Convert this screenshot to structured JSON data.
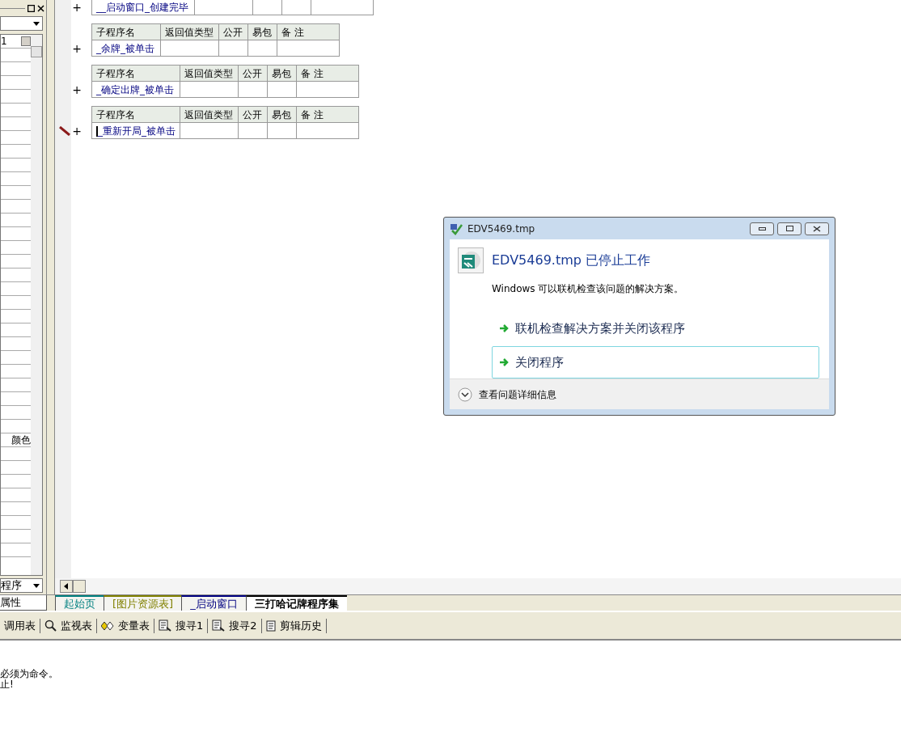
{
  "left_panel": {
    "field_text": "1",
    "rows": [
      {
        "kind": "blank"
      },
      {
        "kind": "blank"
      },
      {
        "kind": "blank"
      },
      {
        "kind": "blank"
      },
      {
        "kind": "blank"
      },
      {
        "kind": "blank"
      },
      {
        "kind": "blank"
      },
      {
        "kind": "blank"
      },
      {
        "kind": "blank"
      },
      {
        "kind": "blank"
      },
      {
        "kind": "blank"
      },
      {
        "kind": "blank"
      },
      {
        "kind": "blank"
      },
      {
        "kind": "blank"
      },
      {
        "kind": "blank"
      },
      {
        "kind": "blank"
      },
      {
        "kind": "blank"
      },
      {
        "kind": "blank"
      },
      {
        "kind": "blank"
      },
      {
        "kind": "blank"
      },
      {
        "kind": "blank"
      },
      {
        "kind": "blank"
      },
      {
        "kind": "blank"
      },
      {
        "kind": "blank"
      },
      {
        "kind": "blank"
      },
      {
        "kind": "blank"
      },
      {
        "kind": "blank"
      },
      {
        "kind": "blank"
      },
      {
        "kind": "text",
        "label": "颜色"
      },
      {
        "kind": "blank"
      },
      {
        "kind": "blank"
      },
      {
        "kind": "blank"
      },
      {
        "kind": "blank"
      },
      {
        "kind": "blank"
      },
      {
        "kind": "blank"
      },
      {
        "kind": "blank"
      },
      {
        "kind": "blank"
      }
    ],
    "dropdown": "程序",
    "tab": "属性"
  },
  "subroutines": [
    {
      "expander": "+",
      "name": "__启动窗口_创建完毕",
      "editing": false
    },
    {
      "expander": "+",
      "headers": [
        "子程序名",
        "返回值类型",
        "公开",
        "易包",
        "备 注"
      ],
      "name": "_余牌_被单击",
      "editing": false
    },
    {
      "expander": "+",
      "headers": [
        "子程序名",
        "返回值类型",
        "公开",
        "易包",
        "备 注"
      ],
      "name": "_确定出牌_被单击",
      "editing": false
    },
    {
      "expander": "+",
      "headers": [
        "子程序名",
        "返回值类型",
        "公开",
        "易包",
        "备 注"
      ],
      "name": "_重新开局_被单击",
      "editing": true
    }
  ],
  "tabs": [
    {
      "label": "起始页",
      "color": "#008080",
      "selected": false
    },
    {
      "label": "[图片资源表]",
      "color": "#808000",
      "selected": false
    },
    {
      "label": "_启动窗口",
      "color": "#000080",
      "selected": false
    },
    {
      "label": "三打哈记牌程序集",
      "color": "#000000",
      "selected": true
    }
  ],
  "toolbar": [
    {
      "kind": "none",
      "label": "调用表"
    },
    {
      "kind": "search",
      "label": "监视表"
    },
    {
      "kind": "vars",
      "label": "变量表"
    },
    {
      "kind": "find",
      "label": "搜寻1"
    },
    {
      "kind": "find",
      "label": "搜寻2"
    },
    {
      "kind": "doc",
      "label": "剪辑历史"
    }
  ],
  "output": [
    "必须为命令。",
    "止!"
  ],
  "dialog": {
    "title": "EDV5469.tmp",
    "heading": "EDV5469.tmp 已停止工作",
    "message": "Windows 可以联机检查该问题的解决方案。",
    "options": [
      {
        "label": "联机检查解决方案并关闭该程序",
        "selected": false
      },
      {
        "label": "关闭程序",
        "selected": true
      }
    ],
    "details": "查看问题详细信息"
  }
}
